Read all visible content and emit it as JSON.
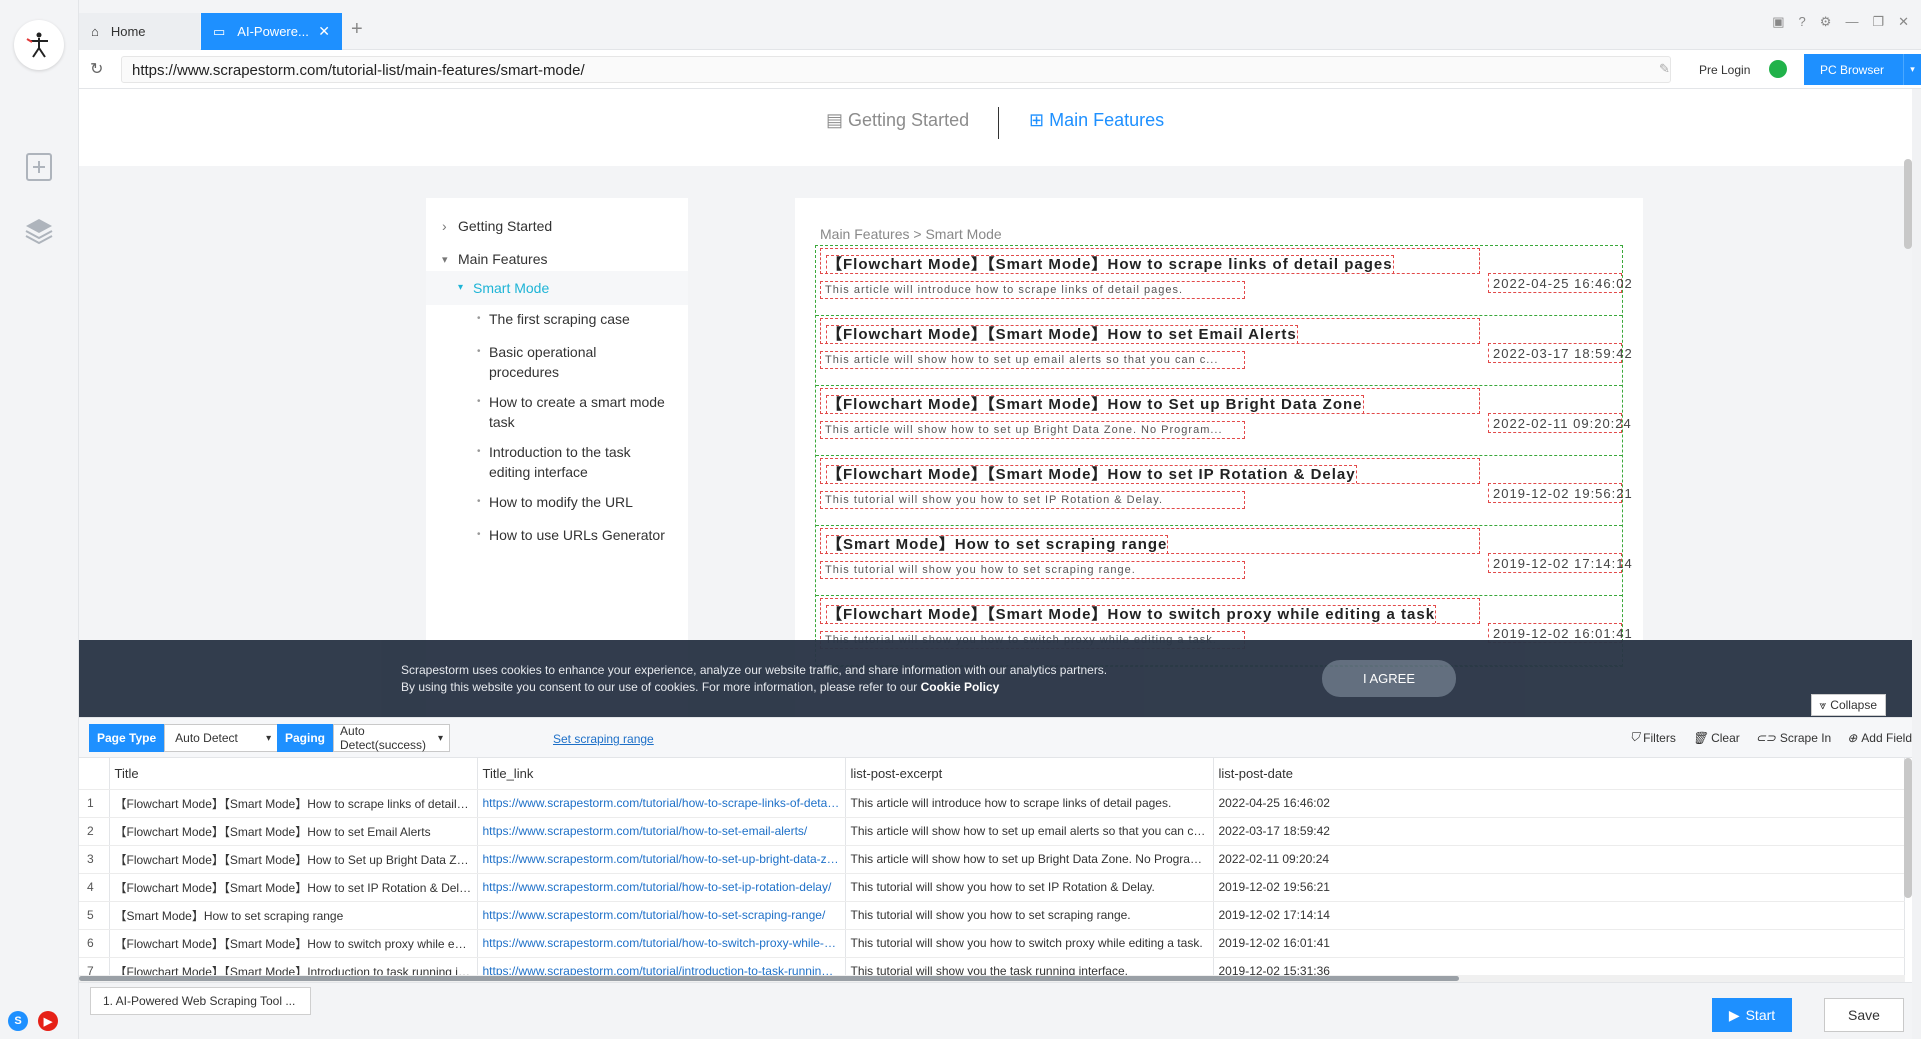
{
  "tabs": {
    "home": "Home",
    "active": "AI-Powere..."
  },
  "address": {
    "url": "https://www.scrapestorm.com/tutorial-list/main-features/smart-mode/",
    "pre_login": "Pre Login",
    "pc_browser": "PC Browser"
  },
  "site": {
    "nav_getting_started": "Getting Started",
    "nav_main_features": "Main Features",
    "sidebar": {
      "getting_started": "Getting Started",
      "main_features": "Main Features",
      "smart_mode": "Smart Mode",
      "items": [
        "The first scraping case",
        "Basic operational procedures",
        "How to create a smart mode task",
        "Introduction to the task editing interface",
        "How to modify the URL",
        "How to use URLs Generator"
      ]
    },
    "breadcrumb": "Main Features > Smart Mode",
    "articles": [
      {
        "title": "【Flowchart Mode】【Smart Mode】How to scrape links of detail pages",
        "excerpt": "This article will introduce how to scrape links of detail pages.",
        "date": "2022-04-25 16:46:02"
      },
      {
        "title": "【Flowchart Mode】【Smart Mode】How to set Email Alerts",
        "excerpt": "This article will show how to set up email alerts so that you can c...",
        "date": "2022-03-17 18:59:42"
      },
      {
        "title": "【Flowchart Mode】【Smart Mode】How to Set up Bright Data Zone",
        "excerpt": "This article will show how to set up Bright Data Zone. No Program...",
        "date": "2022-02-11 09:20:24"
      },
      {
        "title": "【Flowchart Mode】【Smart Mode】How to set IP Rotation & Delay",
        "excerpt": "This tutorial will show you how to set IP Rotation & Delay.",
        "date": "2019-12-02 19:56:21"
      },
      {
        "title": "【Smart Mode】How to set scraping range",
        "excerpt": "This tutorial will show you how to set scraping range.",
        "date": "2019-12-02 17:14:14"
      },
      {
        "title": "【Flowchart Mode】【Smart Mode】How to switch proxy while editing a task",
        "excerpt": "This tutorial will show you how to switch proxy while editing a task.",
        "date": "2019-12-02 16:01:41"
      }
    ]
  },
  "cookie": {
    "line1": "Scrapestorm uses cookies to enhance your experience, analyze our website traffic, and share information with our analytics partners.",
    "line2": "By using this website you consent to our use of cookies. For more information, please refer to our",
    "policy": "Cookie Policy",
    "agree": "I AGREE"
  },
  "toolbar": {
    "collapse": "Collapse",
    "page_type_label": "Page Type",
    "page_type_value": "Auto Detect",
    "paging_label": "Paging",
    "paging_value": "Auto Detect(success)",
    "set_range": "Set scraping range",
    "filters": "Filters",
    "clear": "Clear",
    "scrape_in": "Scrape In",
    "add_field": "Add Field"
  },
  "table": {
    "columns": [
      "Title",
      "Title_link",
      "list-post-excerpt",
      "list-post-date"
    ],
    "rows": [
      [
        "1",
        "【Flowchart Mode】【Smart Mode】How to scrape links of detail pages",
        "https://www.scrapestorm.com/tutorial/how-to-scrape-links-of-detail-pages/",
        "This article will introduce how to scrape links of detail pages.",
        "2022-04-25 16:46:02"
      ],
      [
        "2",
        "【Flowchart Mode】【Smart Mode】How to set Email Alerts",
        "https://www.scrapestorm.com/tutorial/how-to-set-email-alerts/",
        "This article will show how to set up email alerts so that you can complete the op...",
        "2022-03-17 18:59:42"
      ],
      [
        "3",
        "【Flowchart Mode】【Smart Mode】How to Set up Bright Data Zone",
        "https://www.scrapestorm.com/tutorial/how-to-set-up-bright-data-zone/",
        "This article will show how to set up Bright Data Zone. No Programming Needed...",
        "2022-02-11 09:20:24"
      ],
      [
        "4",
        "【Flowchart Mode】【Smart Mode】How to set IP Rotation & Delay",
        "https://www.scrapestorm.com/tutorial/how-to-set-ip-rotation-delay/",
        "This tutorial will show you how to set IP Rotation & Delay.",
        "2019-12-02 19:56:21"
      ],
      [
        "5",
        "【Smart Mode】How to set scraping range",
        "https://www.scrapestorm.com/tutorial/how-to-set-scraping-range/",
        "This tutorial will show you how to set scraping range.",
        "2019-12-02 17:14:14"
      ],
      [
        "6",
        "【Flowchart Mode】【Smart Mode】How to switch proxy while editing a task",
        "https://www.scrapestorm.com/tutorial/how-to-switch-proxy-while-editing-a-task/",
        "This tutorial will show you how to switch proxy while editing a task.",
        "2019-12-02 16:01:41"
      ],
      [
        "7",
        "【Flowchart Mode】【Smart Mode】Introduction to task running interface",
        "https://www.scrapestorm.com/tutorial/introduction-to-task-running-interface/",
        "This tutorial will show you the task running interface.",
        "2019-12-02 15:31:36"
      ]
    ]
  },
  "bottom": {
    "task": "1. AI-Powered Web Scraping Tool ...",
    "start": "Start",
    "save": "Save"
  },
  "colors": {
    "accent": "#1e90ff",
    "link": "#1e70c8",
    "selected": "#1eb4d6",
    "banner": "#2a3546"
  },
  "icons": [
    "app-logo",
    "new-task-icon",
    "layers-icon",
    "home-icon",
    "page-icon",
    "close-icon",
    "plus-icon",
    "refresh-icon",
    "edit-icon",
    "more-icon",
    "filter-icon",
    "trash-icon",
    "link-icon",
    "plus-circle-icon",
    "play-icon",
    "skype-icon",
    "youtube-icon"
  ]
}
